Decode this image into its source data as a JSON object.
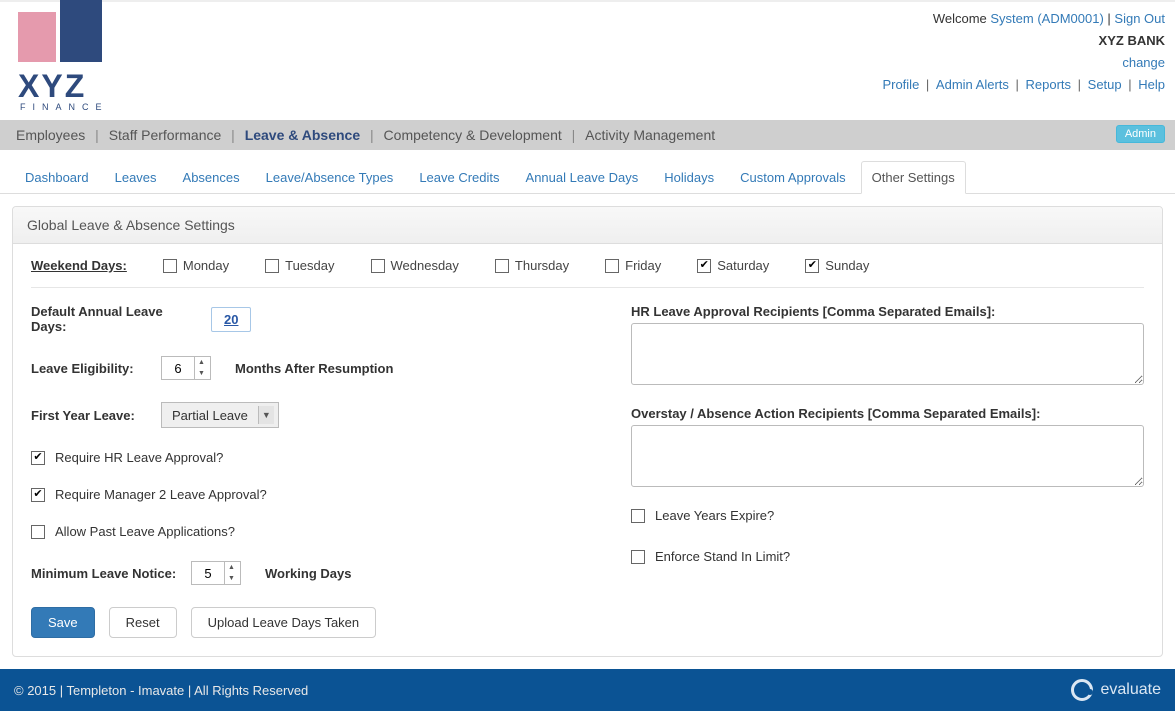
{
  "header": {
    "welcome_prefix": "Welcome ",
    "user_link": "System (ADM0001)",
    "signout": "Sign Out",
    "bank_name": "XYZ BANK",
    "change": "change",
    "links": {
      "profile": "Profile",
      "admin_alerts": "Admin Alerts",
      "reports": "Reports",
      "setup": "Setup",
      "help": "Help"
    },
    "logo_text": "XYZ",
    "logo_sub": "FINANCE"
  },
  "mainnav": {
    "items": [
      "Employees",
      "Staff Performance",
      "Leave & Absence",
      "Competency & Development",
      "Activity Management"
    ],
    "admin_badge": "Admin"
  },
  "subnav": {
    "items": [
      "Dashboard",
      "Leaves",
      "Absences",
      "Leave/Absence Types",
      "Leave Credits",
      "Annual Leave Days",
      "Holidays",
      "Custom Approvals",
      "Other Settings"
    ]
  },
  "panel": {
    "title": "Global Leave & Absence Settings"
  },
  "weekend": {
    "label": "Weekend Days:",
    "days": [
      {
        "name": "Monday",
        "checked": false
      },
      {
        "name": "Tuesday",
        "checked": false
      },
      {
        "name": "Wednesday",
        "checked": false
      },
      {
        "name": "Thursday",
        "checked": false
      },
      {
        "name": "Friday",
        "checked": false
      },
      {
        "name": "Saturday",
        "checked": true
      },
      {
        "name": "Sunday",
        "checked": true
      }
    ]
  },
  "form": {
    "default_annual_label": "Default Annual Leave Days:",
    "default_annual_value": "20",
    "eligibility_label": "Leave Eligibility:",
    "eligibility_value": "6",
    "eligibility_suffix": "Months After Resumption",
    "first_year_label": "First Year Leave:",
    "first_year_value": "Partial Leave",
    "require_hr_label": "Require HR Leave Approval?",
    "require_mgr2_label": "Require Manager 2 Leave Approval?",
    "allow_past_label": "Allow Past Leave Applications?",
    "min_notice_label": "Minimum Leave Notice:",
    "min_notice_value": "5",
    "min_notice_suffix": "Working Days",
    "hr_recipients_label": "HR Leave Approval Recipients [Comma Separated Emails]:",
    "hr_recipients_value": "",
    "overstay_label": "Overstay / Absence Action Recipients [Comma Separated Emails]:",
    "overstay_value": "",
    "leave_expire_label": "Leave Years Expire?",
    "enforce_standin_label": "Enforce Stand In Limit?"
  },
  "buttons": {
    "save": "Save",
    "reset": "Reset",
    "upload": "Upload Leave Days Taken"
  },
  "footer": {
    "copyright": "© 2015 | Templeton - Imavate | All Rights Reserved",
    "brand": "evaluate"
  }
}
